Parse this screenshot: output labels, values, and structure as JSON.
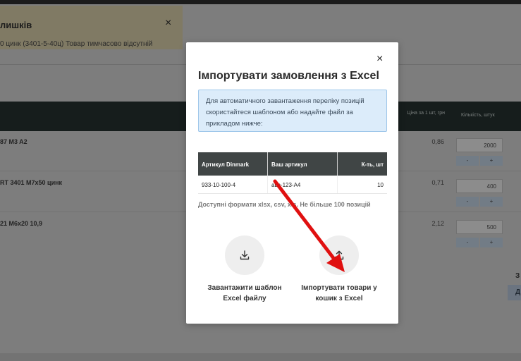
{
  "background": {
    "notice": {
      "title": "лишків",
      "close": "×",
      "text": "0 цинк (3401-5-40ц) Товар тимчасово відсутній"
    },
    "table_header": {
      "price": "Ціна за 1 шт, грн",
      "quantity": "Кількість, штук"
    },
    "rows": [
      {
        "name": "87 M3 A2",
        "price": "0,86",
        "qty": "2000"
      },
      {
        "name": "RT 3401 M7x50 цинк",
        "price": "0,71",
        "qty": "400"
      },
      {
        "name": "21 M6x20 10,9",
        "price": "2,12",
        "qty": "500"
      }
    ],
    "stepper": {
      "minus": "-",
      "plus": "+"
    },
    "side_z": "З",
    "side_d": "Д"
  },
  "modal": {
    "close": "×",
    "title": "Імпортувати замовлення з Excel",
    "info": "Для автоматичного завантаження переліку позицій скористайтеся шаблоном або надайте файл за прикладом нижче:",
    "table": {
      "headers": [
        "Артикул Dinmark",
        "Ваш артикул",
        "К-ть, шт"
      ],
      "row": [
        "933-10-100-4",
        "abc-123-A4",
        "10"
      ]
    },
    "formats": "Доступні формати xlsx, csv, xls. Не більше 100 позицій",
    "download": {
      "label": "Завантажити шаблон Excel файлу",
      "icon": "download-icon"
    },
    "import": {
      "label": "Імпортувати товари у кошик з Excel",
      "icon": "upload-icon"
    }
  },
  "colors": {
    "overlay": "#7f7f7f",
    "info_bg": "#dcecfa",
    "table_header_bg": "#404545",
    "annotation_arrow": "#e01010"
  }
}
